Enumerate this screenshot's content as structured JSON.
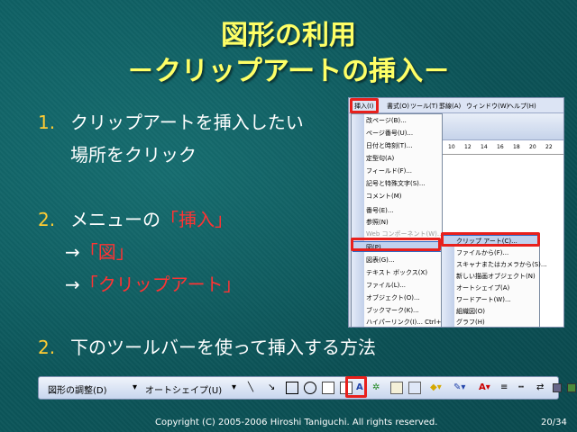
{
  "title": {
    "line1": "図形の利用",
    "line2": "－クリップアートの挿入－"
  },
  "steps": {
    "s1_num": "1.",
    "s1_line1": "クリップアートを挿入したい",
    "s1_line2": "場所をクリック",
    "s2_num": "2.",
    "s2_line1_prefix": "メニューの",
    "s2_line1_red": "「挿入」",
    "s2_line2_arrow": "→",
    "s2_line2_red": "「図」",
    "s2_line3_arrow": "→",
    "s2_line3_red": "「クリップアート」",
    "s3_num": "2.",
    "s3_text": "下のツールバーを使って挿入する方法"
  },
  "menubar": [
    "挿入(I)",
    "書式(O)",
    "ツール(T)",
    "罫線(A)",
    "ウィンドウ(W)",
    "ヘルプ(H)"
  ],
  "ruler_ticks": [
    "10",
    "12",
    "14",
    "16",
    "18",
    "20",
    "22"
  ],
  "insert_menu": [
    "改ページ(B)...",
    "ページ番号(U)...",
    "日付と時刻(T)...",
    "定型句(A)",
    "フィールド(F)...",
    "記号と特殊文字(S)...",
    "コメント(M)",
    "番号(E)...",
    "参照(N)",
    "Web コンポーネント(W)...",
    "図(P)",
    "図表(G)...",
    "テキスト ボックス(X)",
    "ファイル(L)...",
    "オブジェクト(O)...",
    "ブックマーク(K)...",
    "ハイパーリンク(I)...    Ctrl+K"
  ],
  "picture_submenu": [
    "クリップ アート(C)...",
    "ファイルから(F)...",
    "スキャナまたはカメラから(S)...",
    "新しい描画オブジェクト(N)",
    "オートシェイプ(A)",
    "ワードアート(W)...",
    "組織図(O)",
    "グラフ(H)"
  ],
  "drawbar": {
    "draw_label": "図形の調整(D)",
    "autoshape_label": "オートシェイプ(U)"
  },
  "footer": {
    "copyright": "Copyright (C) 2005-2006 Hiroshi Taniguchi. All rights reserved.",
    "page": "20/34"
  },
  "colors": {
    "title": "#ffff66",
    "accent_red": "#ff3333",
    "number": "#ffcc33",
    "highlight_box": "#e8201c"
  }
}
